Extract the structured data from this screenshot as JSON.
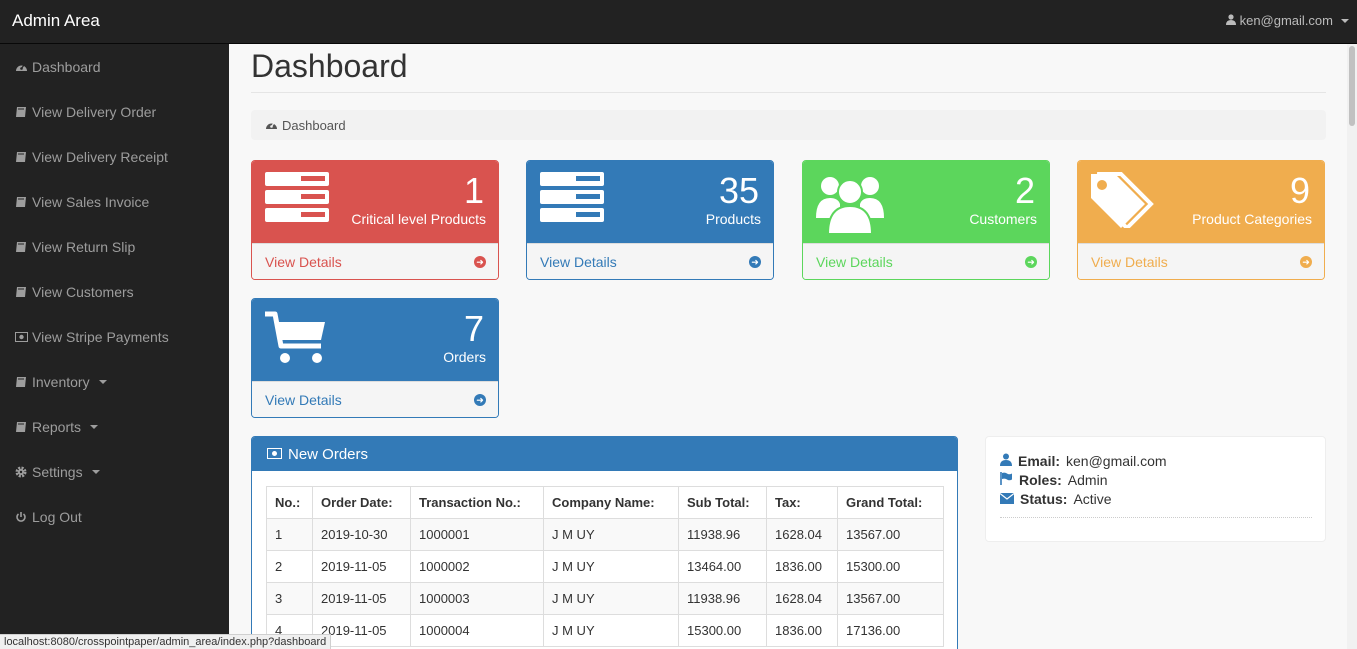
{
  "app": {
    "brand": "Admin Area",
    "user_email": "ken@gmail.com"
  },
  "sidebar": {
    "items": [
      {
        "label": "Dashboard",
        "icon": "dashboard-icon"
      },
      {
        "label": "View Delivery Order",
        "icon": "book-icon"
      },
      {
        "label": "View Delivery Receipt",
        "icon": "book-icon"
      },
      {
        "label": "View Sales Invoice",
        "icon": "book-icon"
      },
      {
        "label": "View Return Slip",
        "icon": "book-icon"
      },
      {
        "label": "View Customers",
        "icon": "book-icon"
      },
      {
        "label": "View Stripe Payments",
        "icon": "money-icon"
      },
      {
        "label": "Inventory",
        "icon": "book-icon",
        "dropdown": true
      },
      {
        "label": "Reports",
        "icon": "book-icon",
        "dropdown": true
      },
      {
        "label": "Settings",
        "icon": "gear-icon",
        "dropdown": true
      },
      {
        "label": "Log Out",
        "icon": "power-icon"
      }
    ]
  },
  "page": {
    "title": "Dashboard",
    "breadcrumb": "Dashboard"
  },
  "stats": [
    {
      "value": "1",
      "label": "Critical level Products",
      "link": "View Details",
      "color": "#d9534f",
      "icon": "server-icon"
    },
    {
      "value": "35",
      "label": "Products",
      "link": "View Details",
      "color": "#337ab7",
      "icon": "server-icon"
    },
    {
      "value": "2",
      "label": "Customers",
      "link": "View Details",
      "color": "#5cd65c",
      "icon": "users-icon"
    },
    {
      "value": "9",
      "label": "Product Categories",
      "link": "View Details",
      "color": "#f0ad4e",
      "icon": "tags-icon"
    },
    {
      "value": "7",
      "label": "Orders",
      "link": "View Details",
      "color": "#337ab7",
      "icon": "cart-icon"
    }
  ],
  "orders": {
    "title": "New Orders",
    "columns": [
      "No.:",
      "Order Date:",
      "Transaction No.:",
      "Company Name:",
      "Sub Total:",
      "Tax:",
      "Grand Total:"
    ],
    "rows": [
      [
        "1",
        "2019-10-30",
        "1000001",
        "J M UY",
        "11938.96",
        "1628.04",
        "13567.00"
      ],
      [
        "2",
        "2019-11-05",
        "1000002",
        "J M UY",
        "13464.00",
        "1836.00",
        "15300.00"
      ],
      [
        "3",
        "2019-11-05",
        "1000003",
        "J M UY",
        "11938.96",
        "1628.04",
        "13567.00"
      ],
      [
        "4",
        "2019-11-05",
        "1000004",
        "J M UY",
        "15300.00",
        "1836.00",
        "17136.00"
      ]
    ]
  },
  "profile": {
    "email_label": "Email:",
    "email": "ken@gmail.com",
    "roles_label": "Roles:",
    "roles": "Admin",
    "status_label": "Status:",
    "status": "Active"
  },
  "statusbar": {
    "url": "localhost:8080/crosspointpaper/admin_area/index.php?dashboard"
  }
}
